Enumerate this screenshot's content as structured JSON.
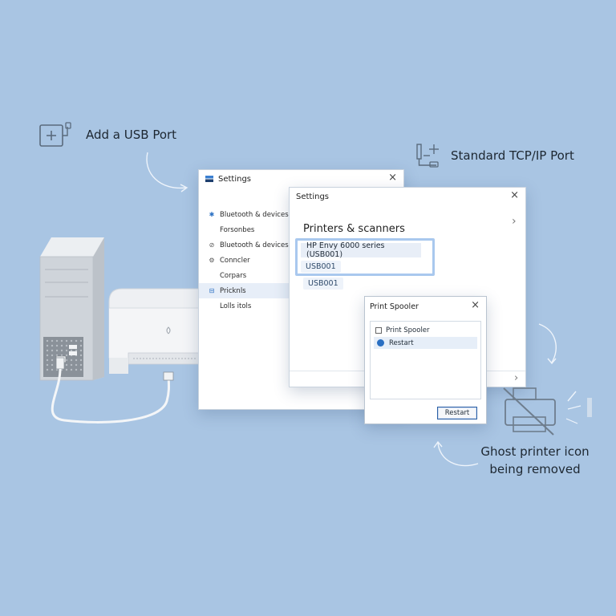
{
  "callouts": {
    "usb": "Add a USB Port",
    "tcpip": "Standard TCP/IP Port",
    "ghost_line1": "Ghost printer icon",
    "ghost_line2": "being removed"
  },
  "settings_window": {
    "title": "Settings",
    "close_glyph": "×",
    "nav_items": [
      {
        "icon": "bluetooth-icon",
        "label": "Bluetooth & devices"
      },
      {
        "icon": "",
        "label": "Forsonbes"
      },
      {
        "icon": "bluetooth-icon",
        "label": "Bluetooth & devices"
      },
      {
        "icon": "",
        "label": "Conncler"
      },
      {
        "icon": "",
        "label": "Corpars"
      },
      {
        "icon": "printer-icon",
        "label": "Pricknls"
      },
      {
        "icon": "",
        "label": "Lolls itols"
      }
    ]
  },
  "printers_window": {
    "title": "Settings",
    "close_glyph": "×",
    "heading": "Printers & scanners",
    "printer_name": "HP Envy 6000 series (USB001)",
    "port_1": "USB001",
    "port_2": "USB001",
    "chevron": "›"
  },
  "spooler_dialog": {
    "title": "Print Spooler",
    "close_glyph": "×",
    "service_name": "Print Spooler",
    "action_label": "Restart",
    "button_label": "Restart"
  },
  "colors": {
    "background": "#a9c5e3",
    "accent": "#2a6fc2",
    "highlight_border": "#8fb7e6"
  }
}
